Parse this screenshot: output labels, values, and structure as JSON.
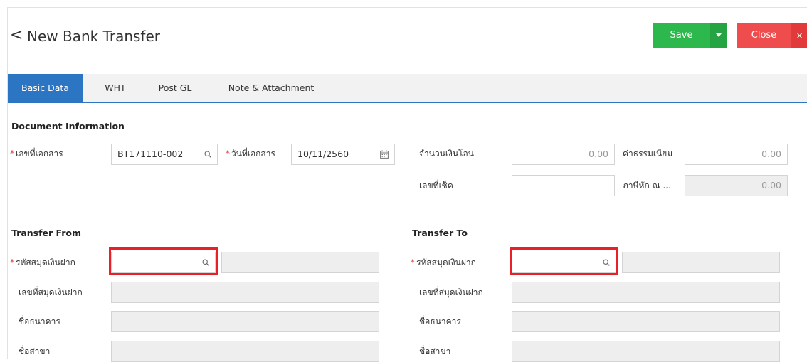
{
  "header": {
    "back_glyph": "<",
    "title": "New Bank Transfer",
    "save_label": "Save",
    "close_label": "Close",
    "close_glyph": "×"
  },
  "tabs": [
    {
      "label": "Basic Data",
      "active": true
    },
    {
      "label": "WHT",
      "active": false
    },
    {
      "label": "Post GL",
      "active": false
    },
    {
      "label": "Note & Attachment",
      "active": false
    }
  ],
  "doc_info": {
    "section_title": "Document Information",
    "doc_no_label": "เลขที่เอกสาร",
    "doc_no_value": "BT171110-002",
    "doc_date_label": "วันที่เอกสาร",
    "doc_date_value": "10/11/2560",
    "amount_label": "จำนวนเงินโอน",
    "amount_value": "0.00",
    "fee_label": "ค่าธรรมเนียม",
    "fee_value": "0.00",
    "cheque_label": "เลขที่เช็ค",
    "cheque_value": "",
    "wht_label": "ภาษีหัก ณ ...",
    "wht_value": "0.00",
    "required_mark": "*"
  },
  "transfer_from": {
    "section_title": "Transfer From",
    "account_code_label": "รหัสสมุดเงินฝาก",
    "account_no_label": "เลขที่สมุดเงินฝาก",
    "bank_name_label": "ชื่อธนาคาร",
    "branch_name_label": "ชื่อสาขา"
  },
  "transfer_to": {
    "section_title": "Transfer To",
    "account_code_label": "รหัสสมุดเงินฝาก",
    "account_no_label": "เลขที่สมุดเงินฝาก",
    "bank_name_label": "ชื่อธนาคาร",
    "branch_name_label": "ชื่อสาขา"
  },
  "colors": {
    "save": "#2db84d",
    "close": "#ef4d4d",
    "tab_active": "#2b75c2",
    "highlight": "#e8202a"
  }
}
